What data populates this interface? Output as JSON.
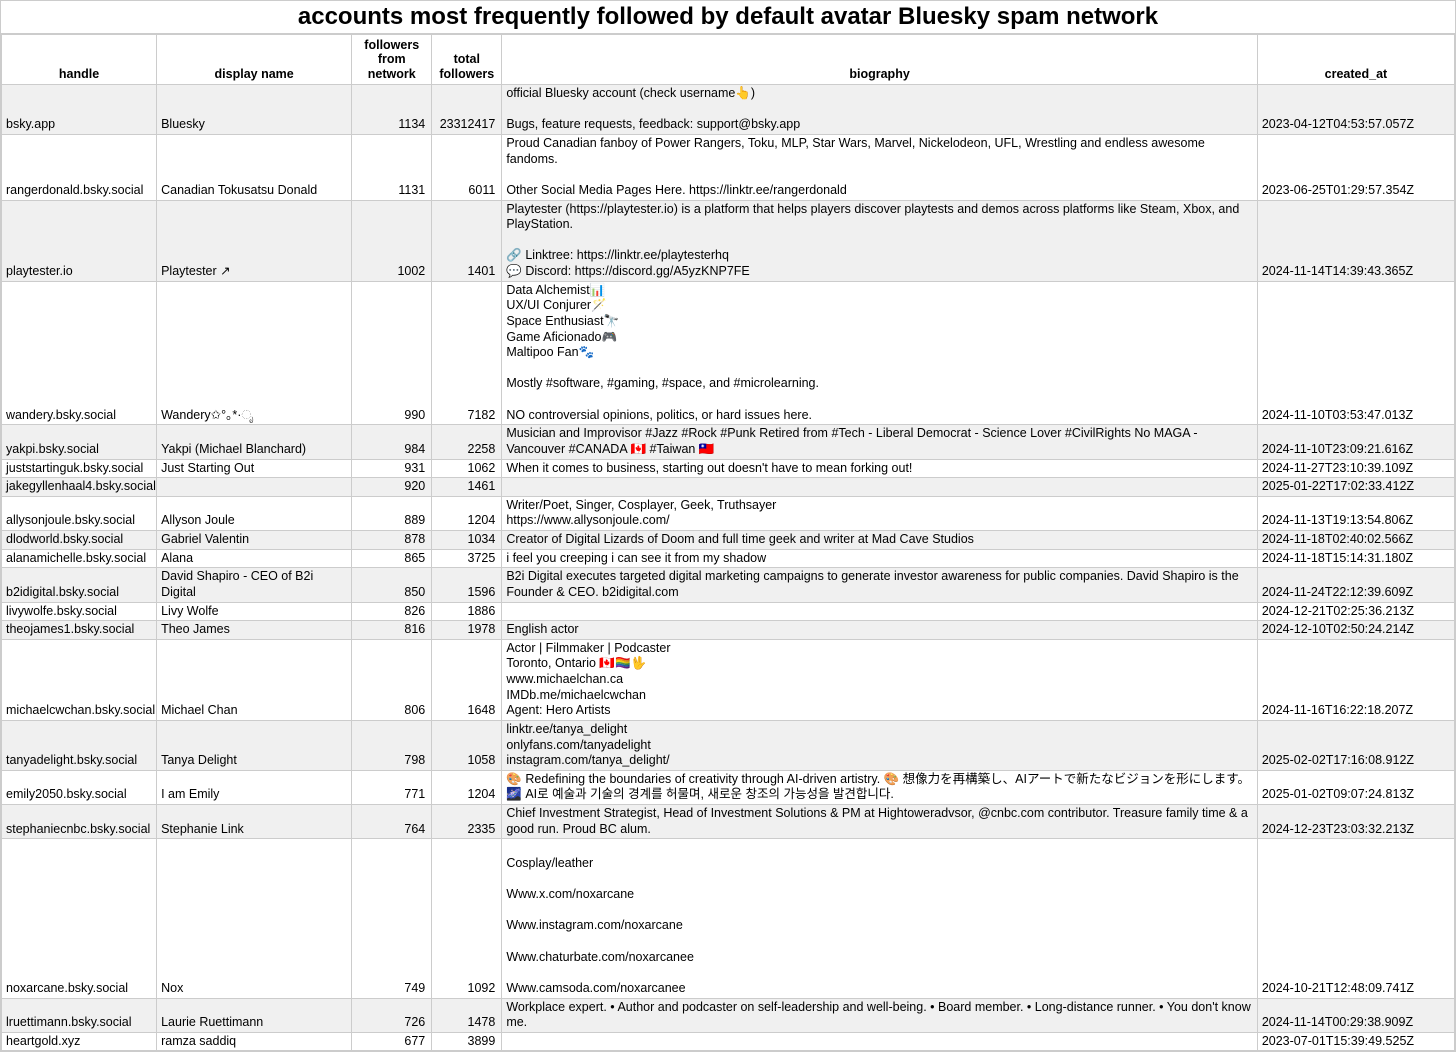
{
  "title": "accounts most frequently followed by default avatar Bluesky spam network",
  "columns": {
    "handle": "handle",
    "display_name": "display name",
    "followers_from_network": "followers\nfrom network",
    "total_followers": "total\nfollowers",
    "biography": "biography",
    "created_at": "created_at"
  },
  "rows": [
    {
      "handle": "bsky.app",
      "display_name": "Bluesky",
      "followers_from_network": "1134",
      "total_followers": "23312417",
      "biography": "official Bluesky account (check username👆)\n\nBugs, feature requests, feedback: support@bsky.app",
      "created_at": "2023-04-12T04:53:57.057Z"
    },
    {
      "handle": "rangerdonald.bsky.social",
      "display_name": "Canadian Tokusatsu Donald",
      "followers_from_network": "1131",
      "total_followers": "6011",
      "biography": "Proud Canadian fanboy of Power Rangers, Toku, MLP, Star Wars, Marvel, Nickelodeon, UFL, Wrestling and endless awesome fandoms.\n\nOther Social Media Pages Here. https://linktr.ee/rangerdonald",
      "created_at": "2023-06-25T01:29:57.354Z"
    },
    {
      "handle": "playtester.io",
      "display_name": "Playtester ↗",
      "followers_from_network": "1002",
      "total_followers": "1401",
      "biography": "Playtester (https://playtester.io) is a platform that helps players discover playtests and demos across platforms like Steam, Xbox, and PlayStation.\n\n🔗 Linktree: https://linktr.ee/playtesterhq\n💬 Discord: https://discord.gg/A5yzKNP7FE",
      "created_at": "2024-11-14T14:39:43.365Z"
    },
    {
      "handle": "wandery.bsky.social",
      "display_name": "Wandery✩°｡*·ೃ",
      "followers_from_network": "990",
      "total_followers": "7182",
      "biography": "Data Alchemist📊\nUX/UI Conjurer🪄\nSpace Enthusiast🔭\nGame Aficionado🎮\nMaltipoo Fan🐾\n\nMostly #software, #gaming, #space, and #microlearning.\n\nNO controversial opinions, politics, or hard issues here.",
      "created_at": "2024-11-10T03:53:47.013Z"
    },
    {
      "handle": "yakpi.bsky.social",
      "display_name": "Yakpi (Michael Blanchard)",
      "followers_from_network": "984",
      "total_followers": "2258",
      "biography": "Musician and Improvisor #Jazz #Rock #Punk Retired from #Tech - Liberal Democrat - Science Lover #CivilRights No MAGA - Vancouver #CANADA 🇨🇦 #Taiwan 🇹🇼",
      "created_at": "2024-11-10T23:09:21.616Z"
    },
    {
      "handle": "juststartinguk.bsky.social",
      "display_name": "Just Starting Out",
      "followers_from_network": "931",
      "total_followers": "1062",
      "biography": "When it comes to business, starting out doesn't have to mean forking out!",
      "created_at": "2024-11-27T23:10:39.109Z"
    },
    {
      "handle": "jakegyllenhaal4.bsky.social",
      "display_name": "",
      "followers_from_network": "920",
      "total_followers": "1461",
      "biography": "",
      "created_at": "2025-01-22T17:02:33.412Z"
    },
    {
      "handle": "allysonjoule.bsky.social",
      "display_name": "Allyson Joule",
      "followers_from_network": "889",
      "total_followers": "1204",
      "biography": "Writer/Poet, Singer, Cosplayer, Geek, Truthsayer\nhttps://www.allysonjoule.com/",
      "created_at": "2024-11-13T19:13:54.806Z"
    },
    {
      "handle": "dlodworld.bsky.social",
      "display_name": "Gabriel Valentin",
      "followers_from_network": "878",
      "total_followers": "1034",
      "biography": "Creator of Digital Lizards of Doom and full time geek and writer at Mad Cave Studios",
      "created_at": "2024-11-18T02:40:02.566Z"
    },
    {
      "handle": "alanamichelle.bsky.social",
      "display_name": "Alana",
      "followers_from_network": "865",
      "total_followers": "3725",
      "biography": "i feel you creeping i can see it from my shadow",
      "created_at": "2024-11-18T15:14:31.180Z"
    },
    {
      "handle": "b2idigital.bsky.social",
      "display_name": "David Shapiro - CEO of B2i Digital",
      "followers_from_network": "850",
      "total_followers": "1596",
      "biography": "B2i Digital executes targeted digital marketing campaigns to generate investor awareness for public companies. David Shapiro is the Founder & CEO. b2idigital.com",
      "created_at": "2024-11-24T22:12:39.609Z"
    },
    {
      "handle": "livywolfe.bsky.social",
      "display_name": "Livy Wolfe",
      "followers_from_network": "826",
      "total_followers": "1886",
      "biography": "",
      "created_at": "2024-12-21T02:25:36.213Z"
    },
    {
      "handle": "theojames1.bsky.social",
      "display_name": "Theo James",
      "followers_from_network": "816",
      "total_followers": "1978",
      "biography": "English actor",
      "created_at": "2024-12-10T02:50:24.214Z"
    },
    {
      "handle": "michaelcwchan.bsky.social",
      "display_name": "Michael Chan",
      "followers_from_network": "806",
      "total_followers": "1648",
      "biography": "Actor | Filmmaker | Podcaster\nToronto, Ontario 🇨🇦🏳️‍🌈🖖\nwww.michaelchan.ca\nIMDb.me/michaelcwchan\nAgent: Hero Artists",
      "created_at": "2024-11-16T16:22:18.207Z"
    },
    {
      "handle": "tanyadelight.bsky.social",
      "display_name": "Tanya Delight",
      "followers_from_network": "798",
      "total_followers": "1058",
      "biography": "linktr.ee/tanya_delight\nonlyfans.com/tanyadelight\ninstagram.com/tanya_delight/",
      "created_at": "2025-02-02T17:16:08.912Z"
    },
    {
      "handle": "emily2050.bsky.social",
      "display_name": "I am Emily",
      "followers_from_network": "771",
      "total_followers": "1204",
      "biography": "🎨 Redefining the boundaries of creativity through AI-driven artistry. 🎨 想像力を再構築し、AIアートで新たなビジョンを形にします。🌌 AI로 예술과 기술의 경계를 허물며, 새로운 창조의 가능성을 발견합니다.",
      "created_at": "2025-01-02T09:07:24.813Z"
    },
    {
      "handle": "stephaniecnbc.bsky.social",
      "display_name": "Stephanie Link",
      "followers_from_network": "764",
      "total_followers": "2335",
      "biography": "Chief Investment Strategist, Head of Investment Solutions & PM at Hightoweradvsor, @cnbc.com contributor. Treasure family time & a good run. Proud BC alum.",
      "created_at": "2024-12-23T23:03:32.213Z"
    },
    {
      "handle": "noxarcane.bsky.social",
      "display_name": "Nox",
      "followers_from_network": "749",
      "total_followers": "1092",
      "biography": "\nCosplay/leather\n\nWww.x.com/noxarcane\n\nWww.instagram.com/noxarcane\n\nWww.chaturbate.com/noxarcanee\n\nWww.camsoda.com/noxarcanee",
      "created_at": "2024-10-21T12:48:09.741Z"
    },
    {
      "handle": "lruettimann.bsky.social",
      "display_name": "Laurie Ruettimann",
      "followers_from_network": "726",
      "total_followers": "1478",
      "biography": "Workplace expert. • Author and podcaster on self-leadership and well-being. • Board member. • Long-distance runner. • You don't know me.",
      "created_at": "2024-11-14T00:29:38.909Z"
    },
    {
      "handle": "heartgold.xyz",
      "display_name": "ramza saddiq",
      "followers_from_network": "677",
      "total_followers": "3899",
      "biography": "",
      "created_at": "2023-07-01T15:39:49.525Z"
    }
  ]
}
